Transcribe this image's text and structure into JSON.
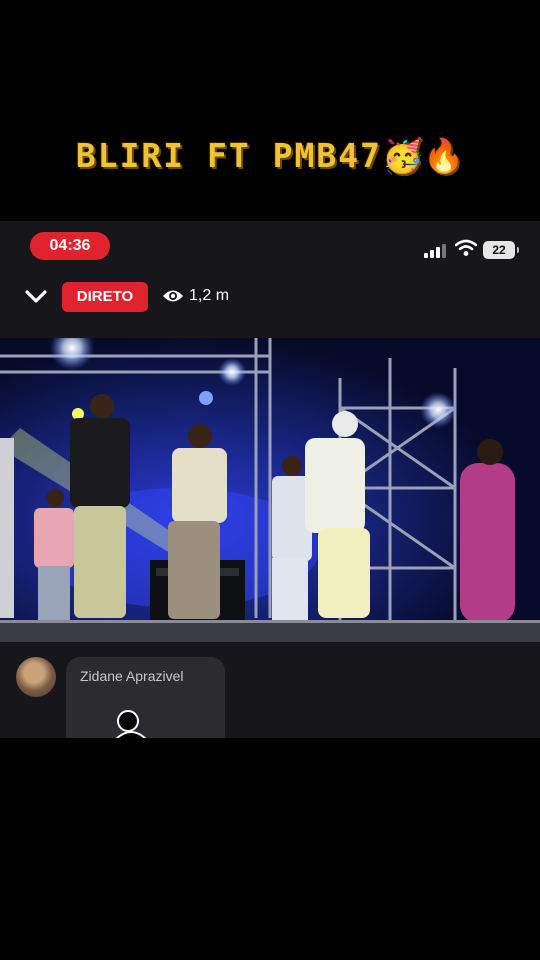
{
  "caption": {
    "text": "BLIRI FT PMB47",
    "emojis": "🥳🔥"
  },
  "status_bar": {
    "time": "04:36",
    "battery_level": "22",
    "accent": "#e1232f"
  },
  "live": {
    "badge_label": "DIRETO",
    "viewers": "1,2 m"
  },
  "comment": {
    "author": "Zidane Aprazivel"
  },
  "icons": [
    "chevron-down-icon",
    "eye-icon",
    "signal-icon",
    "wifi-icon",
    "battery-icon",
    "sticker-icon"
  ],
  "colors": {
    "caption": "#f1c232",
    "live_red": "#e1232f",
    "panel": "#17171b"
  }
}
